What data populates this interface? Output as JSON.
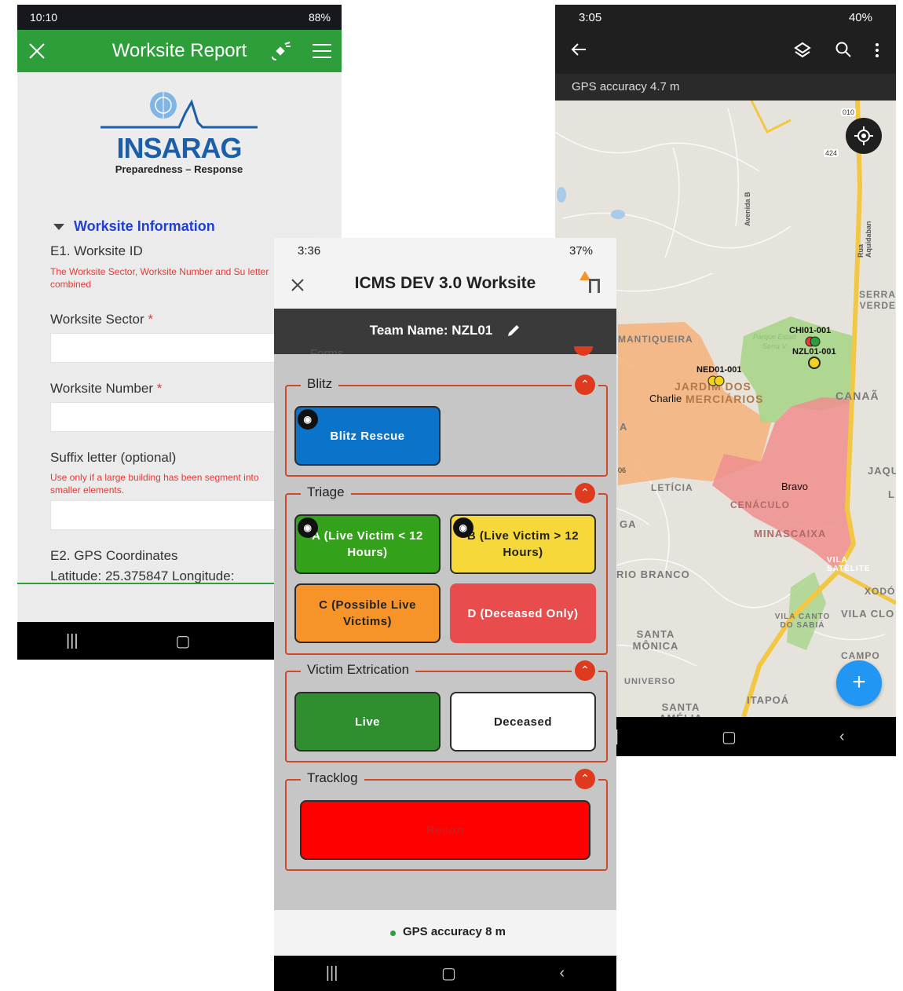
{
  "worksite_report": {
    "status_time": "10:10",
    "status_right": "88%",
    "title": "Worksite Report",
    "logo_text": "INSARAG",
    "logo_tagline": "Preparedness – Response",
    "section_title": "Worksite Information",
    "e1_label": "E1. Worksite ID",
    "e1_help": "The Worksite Sector, Worksite Number and Su letter combined",
    "sector_label": "Worksite Sector",
    "number_label": "Worksite Number",
    "required_mark": "*",
    "suffix_label": "Suffix letter (optional)",
    "suffix_help": "Use only if a large building has been segment into smaller elements.",
    "e2_label": "E2. GPS Coordinates",
    "coords_text": "Latitude: 25.375847 Longitude:"
  },
  "icms": {
    "status_time": "3:36",
    "status_right": "37%",
    "title": "ICMS DEV 3.0 Worksite",
    "team_name": "Team Name: NZL01",
    "forms_partial": "Forms",
    "groups": {
      "blitz": {
        "title": "Blitz",
        "buttons": [
          "Blitz Rescue"
        ]
      },
      "triage": {
        "title": "Triage",
        "buttons": [
          "A (Live Victim < 12 Hours)",
          "B (Live Victim > 12 Hours)",
          "C (Possible Live Victims)",
          "D (Deceased Only)"
        ]
      },
      "extrication": {
        "title": "Victim Extrication",
        "buttons": [
          "Live",
          "Deceased"
        ]
      },
      "tracklog": {
        "title": "Tracklog",
        "buttons": [
          "Recon"
        ]
      }
    },
    "gps_accuracy": "GPS accuracy 8 m",
    "colors": {
      "blitz": "#0b73c9",
      "green": "#33a11a",
      "yellow": "#f7d83a",
      "orange": "#f6942a",
      "red_d": "#e84c4c",
      "live": "#2f8f2f",
      "recon": "#ff0000",
      "group_border": "#d0492c"
    }
  },
  "map_app": {
    "status_time": "3:05",
    "status_right": "40%",
    "gps_accuracy": "GPS accuracy 4.7 m",
    "labels": {
      "serra_verde": "SERRA VERDE",
      "mantiqueira": "MANTIQUEIRA",
      "jardim": "JARDIM DOS",
      "mercearios": "MERCIÁRIOS",
      "canaa": "CANAÃ",
      "leticia": "LETÍCIA",
      "cenaculo": "CENÁCULO",
      "minascaixa": "MINASCAIXA",
      "rio_branco": "RIO BRANCO",
      "jaqu": "JAQU",
      "vila_satelite": "VILA SATÉLITE",
      "xodo": "XODÓ",
      "vila_canto": "VILA CANTO DO SABIÁ",
      "vila_clo": "VILA CLO",
      "santa_monica": "SANTA MÔNICA",
      "campo": "CAMPO",
      "universo": "UNIVERSO",
      "itapoa": "ITAPOÁ",
      "santa_amelia": "SANTA AMÉLIA",
      "avenida": "Avenida B",
      "rua": "Rua Aquidaban",
      "parque": "Parque Estad",
      "serra_v": "Serra V",
      "ga": "GA",
      "a": "A",
      "l": "L",
      "road_010": "010",
      "road_424": "424",
      "road_06": "06"
    },
    "zones": {
      "charlie": "Charlie",
      "bravo": "Bravo"
    },
    "markers": [
      "CHI01-001",
      "NZL01-001",
      "NED01-001"
    ],
    "colors": {
      "charlie": "#f5b27a",
      "bravo": "#ef8e8e",
      "green": "#a8d58a",
      "road": "#f2c744",
      "fab": "#2196f3"
    }
  }
}
